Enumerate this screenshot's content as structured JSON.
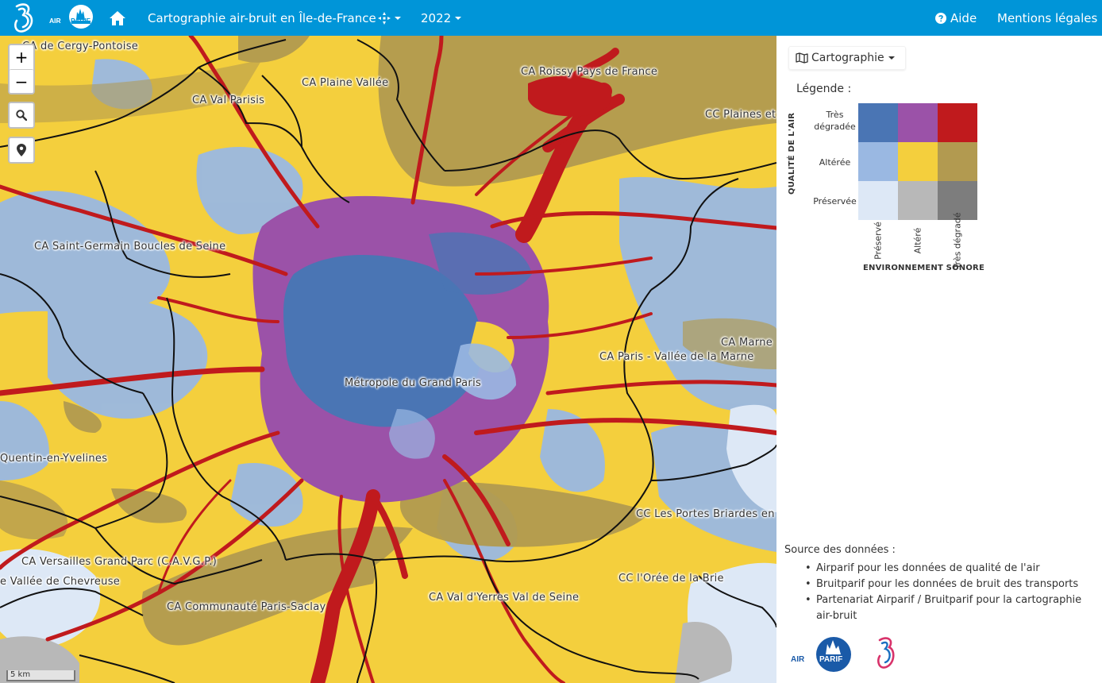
{
  "nav": {
    "title": "Cartographie air-bruit en Île-de-France",
    "year": "2022",
    "help": "Aide",
    "legal": "Mentions légales",
    "brand_color": "#0095d8",
    "airparif_logo_text_a": "AIR",
    "airparif_logo_text_b": "PARIF"
  },
  "map": {
    "labels": [
      "CA de Cergy-Pontoise",
      "CA Plaine Vallée",
      "CA Roissy Pays de France",
      "CA Val Parisis",
      "CC Plaines et",
      "CA Saint-Germain Boucles de Seine",
      "CA Marne",
      "CA Paris - Vallée de la Marne",
      "Métropole du Grand Paris",
      "Quentin-en-Yvelines",
      "CC Les Portes Briardes en",
      "CA Versailles Grand Parc (C.A.V.G.P.)",
      "e Vallée de Chevreuse",
      "CC l'Orée de la Brie",
      "CA Val d'Yerres Val de Seine",
      "CA Communauté Paris-Saclay"
    ],
    "zoom_in": "+",
    "zoom_out": "−",
    "scale": "5 km"
  },
  "panel": {
    "carto_button": "Cartographie",
    "legend_title": "Légende :",
    "air_axis": "QUALITÉ DE L'AIR",
    "noise_axis": "ENVIRONNEMENT SONORE",
    "rows": [
      "Très dégradée",
      "Altérée",
      "Préservée"
    ],
    "cols": [
      "Préservé",
      "Altéré",
      "Très dégradé"
    ],
    "colors": [
      [
        "#4a75b4",
        "#9b52a8",
        "#c01a1d"
      ],
      [
        "#9ab8e2",
        "#f4cf3d",
        "#b29a50"
      ],
      [
        "#dde8f6",
        "#b8b8b8",
        "#7d7d7d"
      ]
    ],
    "source_title": "Source des données :",
    "sources": [
      "Airparif pour les données de qualité de l'air",
      "Bruitparif pour les données de bruit des transports",
      "Partenariat Airparif / Bruitparif pour la cartographie air-bruit"
    ]
  }
}
